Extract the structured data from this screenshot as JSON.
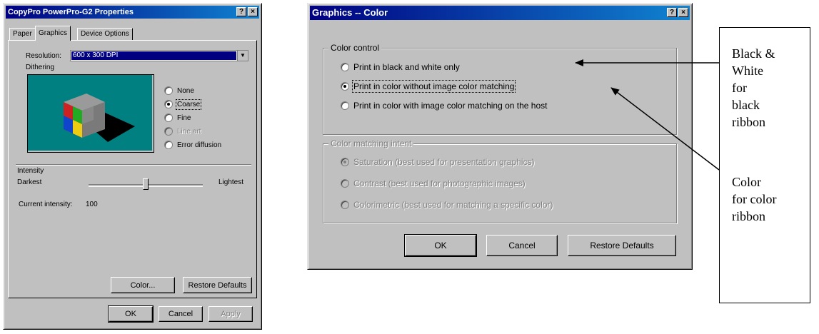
{
  "properties_window": {
    "title": "CopyPro PowerPro-G2 Properties",
    "title_buttons": [
      "?",
      "×"
    ],
    "tabs": [
      {
        "label": "Paper",
        "active": false
      },
      {
        "label": "Graphics",
        "active": true
      },
      {
        "label": "Device Options",
        "active": false
      }
    ],
    "resolution_label": "Resolution:",
    "resolution_value": "600 x 300 DPI",
    "dithering_label": "Dithering",
    "dithering_options": [
      {
        "label": "None",
        "selected": false,
        "enabled": true
      },
      {
        "label": "Coarse",
        "selected": true,
        "enabled": true
      },
      {
        "label": "Fine",
        "selected": false,
        "enabled": true
      },
      {
        "label": "Line art",
        "selected": false,
        "enabled": false
      },
      {
        "label": "Error diffusion",
        "selected": false,
        "enabled": true
      }
    ],
    "intensity_label": "Intensity",
    "darkest_label": "Darkest",
    "lightest_label": "Lightest",
    "intensity_level_percent": 50,
    "current_intensity_label": "Current intensity:",
    "current_intensity_value": "100",
    "color_button": "Color...",
    "restore_defaults_button": "Restore Defaults",
    "ok_button": "OK",
    "cancel_button": "Cancel",
    "apply_button": "Apply",
    "preview_background_color": "#008080"
  },
  "color_dialog": {
    "title": "Graphics -- Color",
    "title_buttons": [
      "?",
      "×"
    ],
    "color_control_label": "Color control",
    "color_options": [
      {
        "label": "Print in black and white only",
        "selected": false
      },
      {
        "label": "Print in color without image color matching",
        "selected": true
      },
      {
        "label": "Print in color with image color matching on the host",
        "selected": false
      }
    ],
    "color_matching_label": "Color matching intent",
    "matching_options": [
      {
        "label": "Saturation (best used for presentation graphics)",
        "selected": true
      },
      {
        "label": "Contrast (best used for photographic images)",
        "selected": false
      },
      {
        "label": "Colorimetric (best used for matching a specific color)",
        "selected": false
      }
    ],
    "ok_button": "OK",
    "cancel_button": "Cancel",
    "restore_defaults_button": "Restore Defaults"
  },
  "annotation": {
    "black_white": [
      "Black &",
      "White",
      "for",
      "black",
      "ribbon"
    ],
    "color": [
      "Color",
      "for color",
      "ribbon"
    ]
  },
  "colors": {
    "window_face": "#c0c0c0",
    "title_bar": "#000080",
    "selection": "#000080"
  }
}
